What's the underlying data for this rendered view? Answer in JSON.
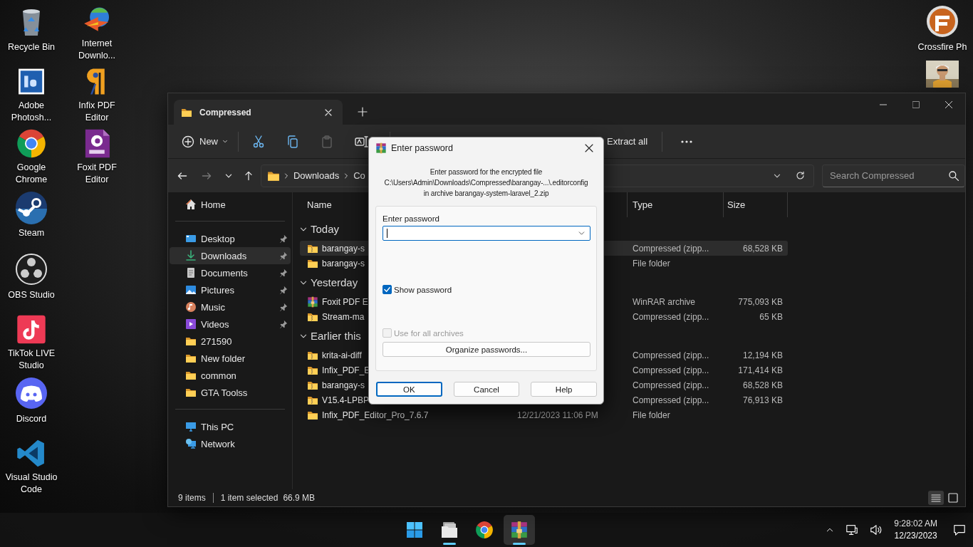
{
  "desktop": {
    "icons": [
      {
        "label": "Recycle Bin"
      },
      {
        "label": "Adobe Photosh..."
      },
      {
        "label": "Google Chrome"
      },
      {
        "label": "Steam"
      },
      {
        "label": "OBS Studio"
      },
      {
        "label": "TikTok LIVE Studio"
      },
      {
        "label": "Discord"
      },
      {
        "label": "Visual Studio Code"
      },
      {
        "label": "Internet Downlo..."
      },
      {
        "label": "Infix PDF Editor"
      },
      {
        "label": "Foxit PDF Editor"
      }
    ],
    "right_icons": [
      {
        "kind": "shortcut",
        "label": "Crossfire Ph"
      },
      {
        "kind": "picture"
      }
    ]
  },
  "explorer": {
    "tab": {
      "title": "Compressed"
    },
    "toolbar": [
      {
        "kind": "new",
        "label": "New",
        "disabled": false
      },
      {
        "kind": "cut",
        "disabled": false
      },
      {
        "kind": "copy",
        "disabled": false
      },
      {
        "kind": "paste",
        "disabled": true
      },
      {
        "kind": "rename",
        "disabled": false
      },
      {
        "kind": "extract",
        "label": "Extract all",
        "disabled": false
      },
      {
        "kind": "more",
        "disabled": false
      }
    ],
    "nav": [
      {
        "kind": "back",
        "disabled": false
      },
      {
        "kind": "forward",
        "disabled": true
      },
      {
        "kind": "recent",
        "disabled": false
      },
      {
        "kind": "up",
        "disabled": false
      }
    ],
    "address": {
      "segments": [
        "Downloads",
        "Co"
      ]
    },
    "search": {
      "placeholder": "Search Compressed"
    },
    "sidebar": {
      "sections": [
        {
          "items": [
            {
              "label": "Home",
              "pinned": false,
              "selected": false
            }
          ]
        },
        {
          "items": [
            {
              "label": "Desktop",
              "pinned": true,
              "selected": false
            },
            {
              "label": "Downloads",
              "pinned": true,
              "selected": true
            },
            {
              "label": "Documents",
              "pinned": true,
              "selected": false
            },
            {
              "label": "Pictures",
              "pinned": true,
              "selected": false
            },
            {
              "label": "Music",
              "pinned": true,
              "selected": false
            },
            {
              "label": "Videos",
              "pinned": true,
              "selected": false
            },
            {
              "label": "271590",
              "pinned": false,
              "selected": false
            },
            {
              "label": "New folder",
              "pinned": false,
              "selected": false
            },
            {
              "label": "common",
              "pinned": false,
              "selected": false
            },
            {
              "label": "GTA Toolss",
              "pinned": false,
              "selected": false
            }
          ]
        },
        {
          "items": [
            {
              "label": "This PC",
              "pinned": false,
              "selected": false
            },
            {
              "label": "Network",
              "pinned": false,
              "selected": false
            }
          ]
        }
      ]
    },
    "columns": [
      "Name",
      "Type",
      "Size"
    ],
    "groups": [
      {
        "title": "Today",
        "expanded": true,
        "rows": [
          {
            "kind": "zip",
            "name": "barangay-s",
            "type": "Compressed (zipp...",
            "size": "68,528 KB",
            "selected": true
          },
          {
            "kind": "folder",
            "name": "barangay-s",
            "type": "File folder",
            "selected": false
          }
        ]
      },
      {
        "title": "Yesterday",
        "expanded": true,
        "rows": [
          {
            "kind": "rar",
            "name": "Foxit PDF E",
            "type": "WinRAR archive",
            "size": "775,093 KB",
            "selected": false
          },
          {
            "kind": "zip",
            "name": "Stream-ma",
            "type": "Compressed (zipp...",
            "size": "65 KB",
            "selected": false
          }
        ]
      },
      {
        "title": "Earlier this",
        "expanded": true,
        "rows": [
          {
            "kind": "zip",
            "name": "krita-ai-diff",
            "type": "Compressed (zipp...",
            "size": "12,194 KB",
            "selected": false
          },
          {
            "kind": "zip",
            "name": "Infix_PDF_E",
            "type": "Compressed (zipp...",
            "size": "171,414 KB",
            "selected": false
          },
          {
            "kind": "zip",
            "name": "barangay-s",
            "type": "Compressed (zipp...",
            "size": "68,528 KB",
            "selected": false
          },
          {
            "kind": "zip",
            "name": "V15.4-LPBP",
            "type": "Compressed (zipp...",
            "size": "76,913 KB",
            "selected": false
          },
          {
            "kind": "folder",
            "name": "Infix_PDF_Editor_Pro_7.6.7",
            "date": "12/21/2023 11:06 PM",
            "type": "File folder",
            "selected": false
          }
        ]
      }
    ],
    "status": {
      "count": "9 items",
      "selection": "1 item selected",
      "size": "66.9 MB"
    },
    "views": [
      {
        "kind": "details",
        "selected": true
      },
      {
        "kind": "tiles",
        "selected": false
      }
    ]
  },
  "dialog": {
    "title": "Enter password",
    "message": [
      "Enter password for the encrypted file",
      "C:\\Users\\Admin\\Downloads\\Compressed\\barangay-...\\.editorconfig",
      "in archive barangay-system-laravel_2.zip"
    ],
    "password_label": "Enter password",
    "options": [
      {
        "label": "Show password",
        "checked": true,
        "disabled": false
      },
      {
        "label": "Use for all archives",
        "checked": false,
        "disabled": true
      }
    ],
    "organize_button": "Organize passwords...",
    "buttons": [
      {
        "label": "OK",
        "default": true
      },
      {
        "label": "Cancel",
        "default": false
      },
      {
        "label": "Help",
        "default": false
      }
    ]
  },
  "taskbar": {
    "apps": [
      {
        "running": false,
        "active": false
      },
      {
        "running": true,
        "active": false
      },
      {
        "running": false,
        "active": false
      },
      {
        "running": true,
        "active": true
      }
    ],
    "clock": {
      "time": "9:28:02 AM",
      "date": "12/23/2023"
    }
  }
}
